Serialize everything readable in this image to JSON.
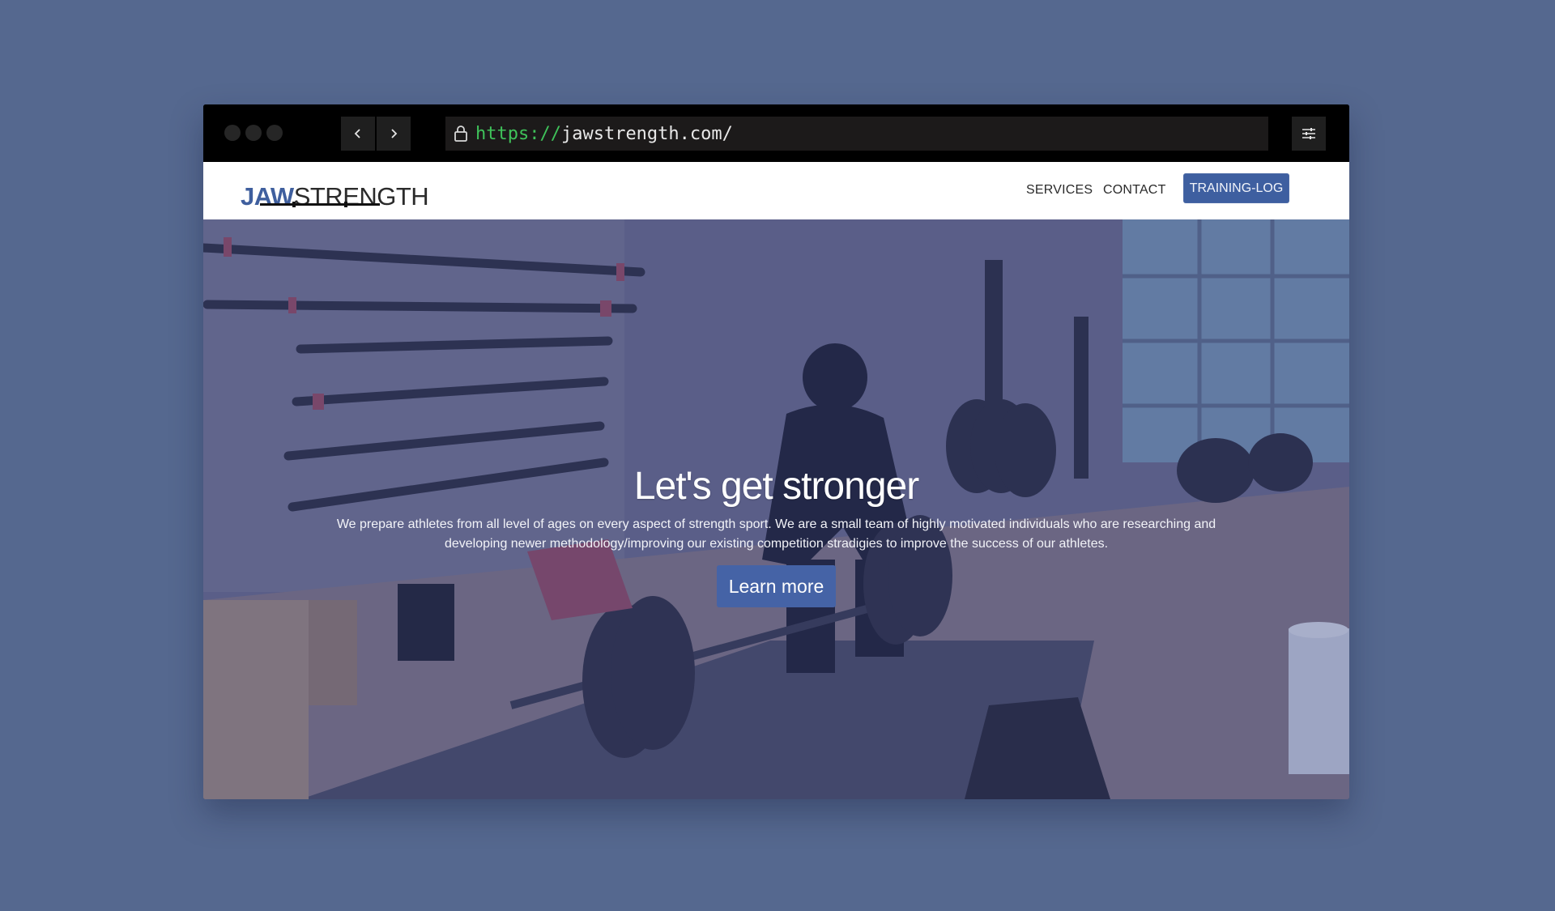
{
  "browser": {
    "url_scheme": "https://",
    "url_rest": "jawstrength.com/",
    "back_icon": "chevron-left-icon",
    "forward_icon": "chevron-right-icon",
    "lock_icon": "lock-icon",
    "settings_icon": "sliders-icon"
  },
  "header": {
    "logo_bold": "JAW",
    "logo_light": "STRENGTH",
    "nav": {
      "services": "SERVICES",
      "contact": "CONTACT",
      "training_log": "TRAINING-LOG"
    }
  },
  "hero": {
    "title": "Let's get stronger",
    "text": "We prepare athletes from all level of ages on every aspect of strength sport. We are a small team of highly motivated individuals who are researching and developing newer methodology/improving our existing competition stradigies to improve the success of our athletes.",
    "button": "Learn more"
  },
  "colors": {
    "background": "#55688f",
    "brand_blue": "#3e5fa0",
    "url_scheme_green": "#3fc25a"
  }
}
